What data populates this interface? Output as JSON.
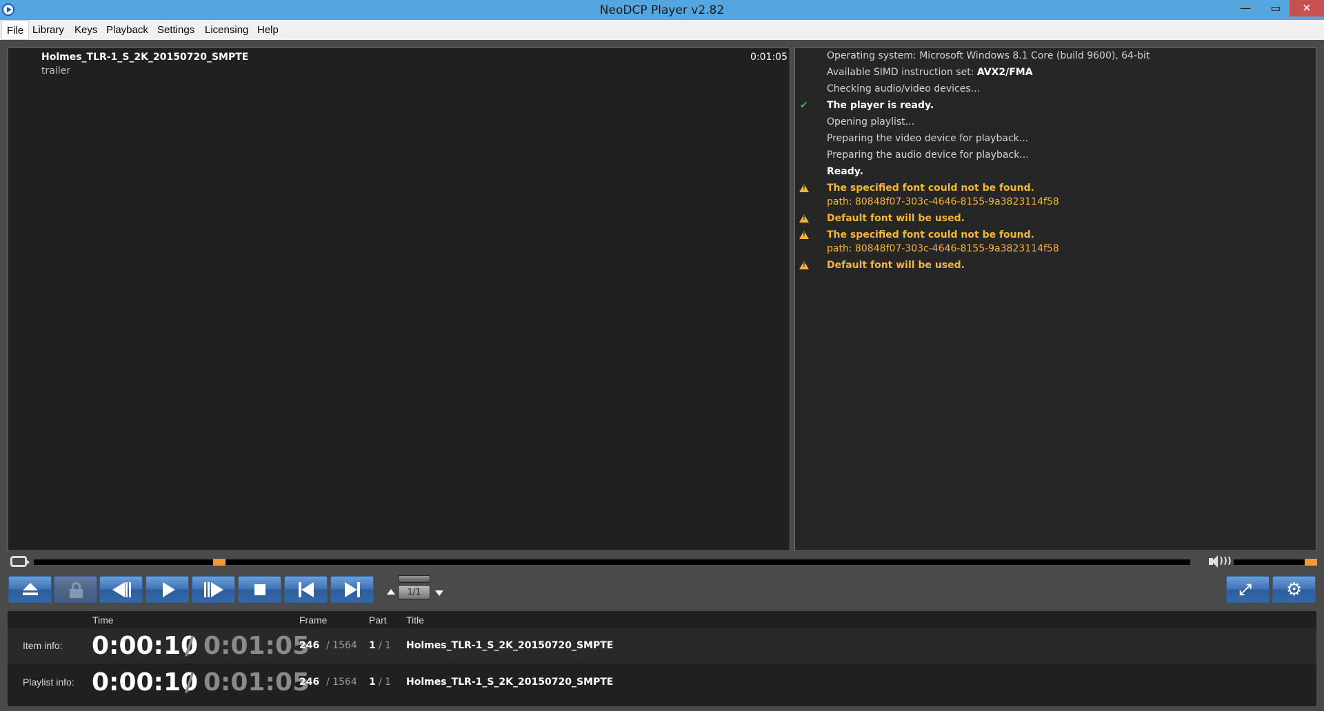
{
  "window": {
    "title": "NeoDCP Player v2.82",
    "minimize_glyph": "—",
    "maximize_glyph": "▭",
    "close_glyph": "✕"
  },
  "menu": [
    {
      "label": "File",
      "active": true
    },
    {
      "label": "Library"
    },
    {
      "label": "Keys"
    },
    {
      "label": "Playback"
    },
    {
      "label": "Settings"
    },
    {
      "label": "Licensing"
    },
    {
      "label": "Help"
    }
  ],
  "playlist": {
    "item_title": "Holmes_TLR-1_S_2K_20150720_SMPTE",
    "item_kind": "trailer",
    "item_duration": "0:01:05"
  },
  "log": {
    "lines": [
      {
        "text": "Operating system: Microsoft Windows 8.1 Core (build 9600), 64-bit",
        "style": "normal"
      },
      {
        "text": "Available SIMD instruction set: ",
        "bold_suffix": "AVX2/FMA",
        "style": "normal"
      },
      {
        "text": "Checking audio/video devices...",
        "style": "normal"
      },
      {
        "text": "The player is ready.",
        "style": "bold",
        "icon": "checkmark-icon"
      },
      {
        "text": "Opening playlist...",
        "style": "normal"
      },
      {
        "text": "Preparing the video device for playback...",
        "style": "normal"
      },
      {
        "text": "Preparing the audio device for playback...",
        "style": "normal"
      },
      {
        "text": "Ready.",
        "style": "bold"
      },
      {
        "text": "The specified font could not be found.",
        "style": "warn",
        "icon": "warning-icon"
      },
      {
        "text": "path: 80848f07-303c-4646-8155-9a3823114f58",
        "style": "warnpath"
      },
      {
        "text": "Default font will be used.",
        "style": "warn",
        "icon": "warning-icon"
      },
      {
        "text": "The specified font could not be found.",
        "style": "warn",
        "icon": "warning-icon"
      },
      {
        "text": "path: 80848f07-303c-4646-8155-9a3823114f58",
        "style": "warnpath"
      },
      {
        "text": "Default font will be used.",
        "style": "warn",
        "icon": "warning-icon"
      }
    ]
  },
  "seek": {
    "position_fraction": 0.157
  },
  "volume": {
    "level_fraction": 1.0
  },
  "transport": {
    "buttons": [
      "eject-icon",
      "lock-icon",
      "step-back-icon",
      "play-icon",
      "step-forward-icon",
      "stop-icon",
      "skip-previous-icon",
      "skip-next-icon"
    ],
    "part_selector": "1/1",
    "right_buttons": [
      "fullscreen-icon",
      "gear-icon"
    ]
  },
  "info": {
    "headers": {
      "time": "Time",
      "frame": "Frame",
      "part": "Part",
      "title": "Title"
    },
    "separator": "/",
    "item": {
      "label": "Item info:",
      "time_current": "0:00:10",
      "time_total": "0:01:05",
      "frame_current": "246",
      "frame_total": "/ 1564",
      "part_current": "1",
      "part_total": "/ 1",
      "title": "Holmes_TLR-1_S_2K_20150720_SMPTE"
    },
    "playlist": {
      "label": "Playlist info:",
      "time_current": "0:00:10",
      "time_total": "0:01:05",
      "frame_current": "246",
      "frame_total": "/ 1564",
      "part_current": "1",
      "part_total": "/ 1",
      "title": "Holmes_TLR-1_S_2K_20150720_SMPTE"
    }
  },
  "colors": {
    "titlebar": "#55a6de",
    "accent_orange": "#f39a35",
    "warning": "#f6b638",
    "ok_green": "#2ec23a",
    "button_blue": "#3e73b7"
  }
}
